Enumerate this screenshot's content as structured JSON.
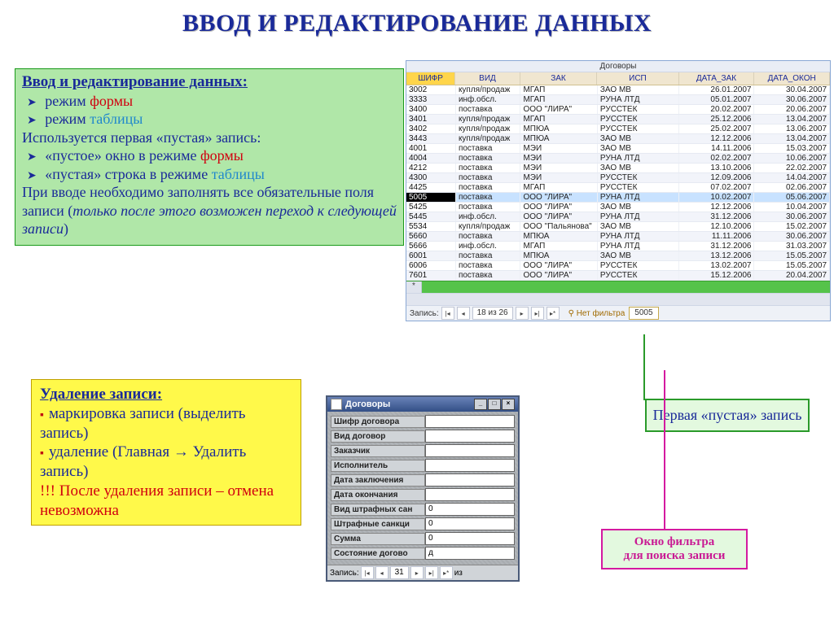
{
  "title": "ВВОД И РЕДАКТИРОВАНИЕ ДАННЫХ",
  "panel1": {
    "heading": "Ввод и редактирование данных:",
    "b1a": "режим ",
    "b1b": "формы",
    "b2a": "режим ",
    "b2b": "таблицы",
    "l3": "Используется первая «пустая» запись:",
    "b4a": "«пустое» окно в режиме ",
    "b4b": "формы",
    "b5a": "«пустая» строка в режиме ",
    "b5b": "таблицы",
    "l6a": "При вводе необходимо заполнять все обязательные поля записи (",
    "l6b": "только после этого возможен переход к следующей записи",
    "l6c": ")"
  },
  "panel2": {
    "heading": "Удаление записи:",
    "b1": "маркировка записи (выделить запись)",
    "b2": "удаление (Главная → Удалить запись)",
    "warn": "!!! После удаления записи – отмена невозможна"
  },
  "datasheet": {
    "title": "Договоры",
    "cols": [
      "ШИФР",
      "ВИД",
      "ЗАК",
      "ИСП",
      "ДАТА_ЗАК",
      "ДАТА_ОКОН"
    ],
    "rows": [
      [
        "3002",
        "купля/продаж",
        "МГАП",
        "ЗАО МВ",
        "26.01.2007",
        "30.04.2007"
      ],
      [
        "3333",
        "инф.обсл.",
        "МГАП",
        "РУНА ЛТД",
        "05.01.2007",
        "30.06.2007"
      ],
      [
        "3400",
        "поставка",
        "ООО \"ЛИРА\"",
        "РУССТЕК",
        "20.02.2007",
        "20.06.2007"
      ],
      [
        "3401",
        "купля/продаж",
        "МГАП",
        "РУССТЕК",
        "25.12.2006",
        "13.04.2007"
      ],
      [
        "3402",
        "купля/продаж",
        "МПЮА",
        "РУССТЕК",
        "25.02.2007",
        "13.06.2007"
      ],
      [
        "3443",
        "купля/продаж",
        "МПЮА",
        "ЗАО МВ",
        "12.12.2006",
        "13.04.2007"
      ],
      [
        "4001",
        "поставка",
        "МЭИ",
        "ЗАО МВ",
        "14.11.2006",
        "15.03.2007"
      ],
      [
        "4004",
        "поставка",
        "МЭИ",
        "РУНА ЛТД",
        "02.02.2007",
        "10.06.2007"
      ],
      [
        "4212",
        "поставка",
        "МЭИ",
        "ЗАО МВ",
        "13.10.2006",
        "22.02.2007"
      ],
      [
        "4300",
        "поставка",
        "МЭИ",
        "РУССТЕК",
        "12.09.2006",
        "14.04.2007"
      ],
      [
        "4425",
        "поставка",
        "МГАП",
        "РУССТЕК",
        "07.02.2007",
        "02.06.2007"
      ],
      [
        "5005",
        "поставка",
        "ООО \"ЛИРА\"",
        "РУНА ЛТД",
        "10.02.2007",
        "05.06.2007"
      ],
      [
        "5425",
        "поставка",
        "ООО \"ЛИРА\"",
        "ЗАО МВ",
        "12.12.2006",
        "10.04.2007"
      ],
      [
        "5445",
        "инф.обсл.",
        "ООО \"ЛИРА\"",
        "РУНА ЛТД",
        "31.12.2006",
        "30.06.2007"
      ],
      [
        "5534",
        "купля/продаж",
        "ООО \"Пальянова\"",
        "ЗАО МВ",
        "12.10.2006",
        "15.02.2007"
      ],
      [
        "5660",
        "поставка",
        "МПЮА",
        "РУНА ЛТД",
        "11.11.2006",
        "30.06.2007"
      ],
      [
        "5666",
        "инф.обсл.",
        "МГАП",
        "РУНА ЛТД",
        "31.12.2006",
        "31.03.2007"
      ],
      [
        "6001",
        "поставка",
        "МПЮА",
        "ЗАО МВ",
        "13.12.2006",
        "15.05.2007"
      ],
      [
        "6006",
        "поставка",
        "ООО \"ЛИРА\"",
        "РУССТЕК",
        "13.02.2007",
        "15.05.2007"
      ],
      [
        "7601",
        "поставка",
        "ООО \"ЛИРА\"",
        "РУССТЕК",
        "15.12.2006",
        "20.04.2007"
      ]
    ],
    "selected_index": 11,
    "nav": {
      "label": "Запись:",
      "pos": "18 из 26",
      "nofilter": "Нет фильтра",
      "search": "5005"
    }
  },
  "form": {
    "title": "Договоры",
    "fields": [
      {
        "label": "Шифр договора",
        "val": ""
      },
      {
        "label": "Вид договор",
        "val": ""
      },
      {
        "label": "Заказчик",
        "val": ""
      },
      {
        "label": "Исполнитель",
        "val": ""
      },
      {
        "label": "Дата заключения",
        "val": ""
      },
      {
        "label": "Дата окончания",
        "val": ""
      },
      {
        "label": "Вид штрафных сан",
        "val": "0"
      },
      {
        "label": "Штрафные санкци",
        "val": "0"
      },
      {
        "label": "Сумма",
        "val": "0"
      },
      {
        "label": "Состояние догово",
        "val": "д"
      }
    ],
    "nav": {
      "label": "Запись:",
      "pos": "31",
      "suffix": "из"
    }
  },
  "callouts": {
    "empty": "Первая «пустая» запись",
    "filter1": "Окно фильтра",
    "filter2": "для поиска записи"
  }
}
